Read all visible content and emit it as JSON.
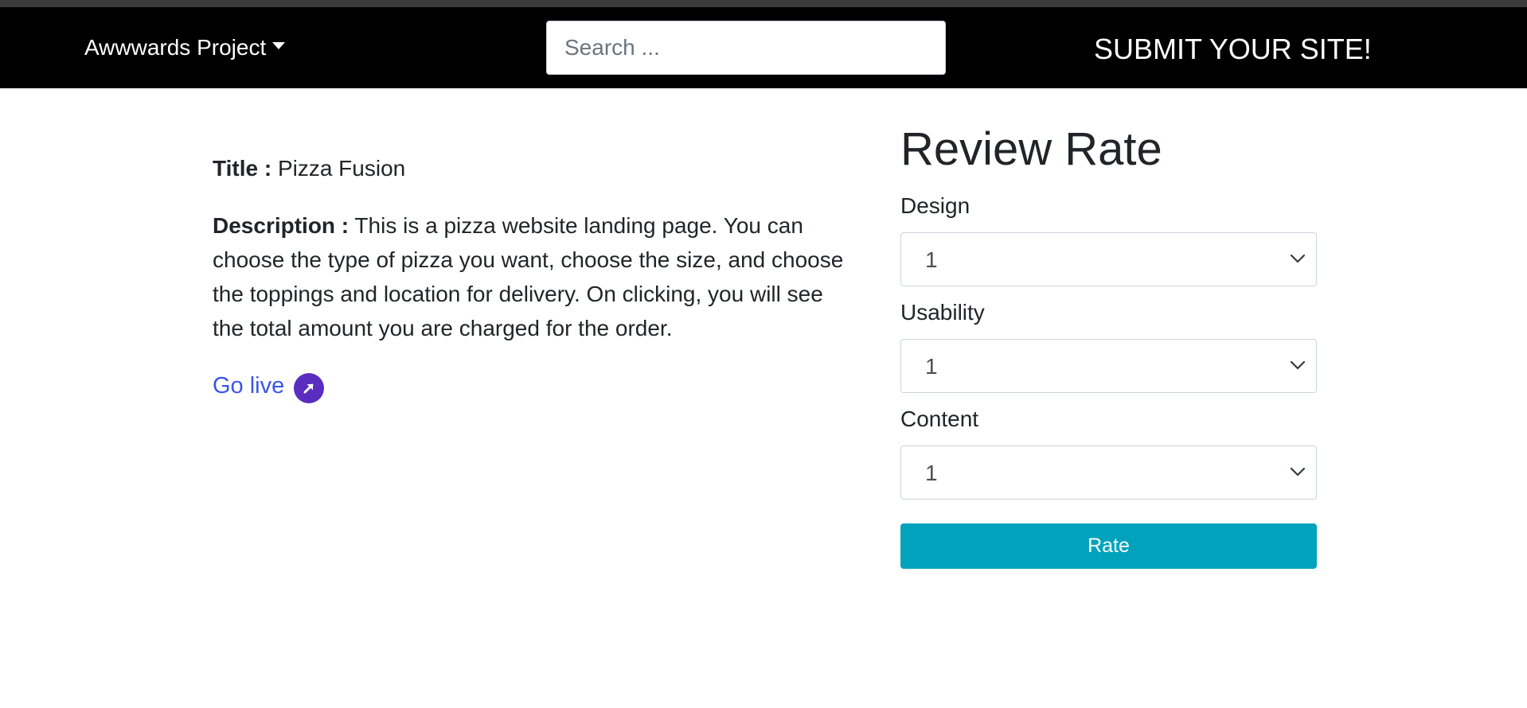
{
  "nav": {
    "brand": "Awwwards Project",
    "brand_caret_icon": "caret-down-icon",
    "search_placeholder": "Search ...",
    "submit_label": "SUBMIT YOUR SITE!"
  },
  "project": {
    "title_label": "Title :",
    "title": "Pizza Fusion",
    "description_label": "Description :",
    "description": "This is a pizza website landing page. You can choose the type of pizza you want, choose the size, and choose the toppings and location for delivery. On clicking, you will see the total amount you are charged for the order.",
    "golive_label": "Go live",
    "golive_icon": "external-link-arrow-icon"
  },
  "review": {
    "heading": "Review Rate",
    "fields": [
      {
        "label": "Design",
        "value": "1"
      },
      {
        "label": "Usability",
        "value": "1"
      },
      {
        "label": "Content",
        "value": "1"
      }
    ],
    "submit_label": "Rate"
  },
  "colors": {
    "navbar": "#000000",
    "link": "#3b55e6",
    "golive_icon_bg": "#5a2dc1",
    "rate_button": "#00a3bb"
  }
}
